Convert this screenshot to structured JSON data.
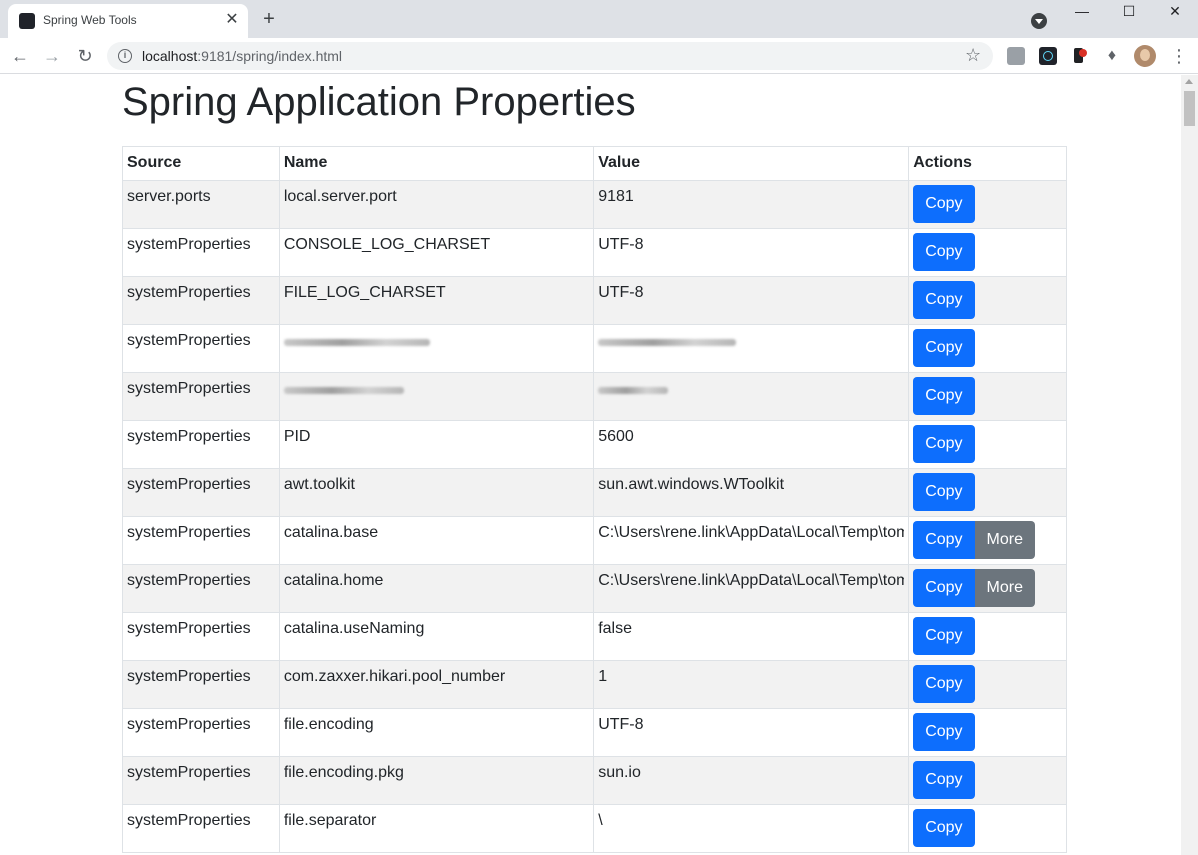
{
  "browser": {
    "tab_title": "Spring Web Tools",
    "tab_close": "✕",
    "new_tab": "+",
    "url_host": "localhost",
    "url_rest": ":9181/spring/index.html",
    "window_controls": {
      "minimize": "—",
      "maximize": "☐",
      "close": "✕"
    },
    "icons": [
      "react-favicon",
      "back-arrow-icon",
      "forward-arrow-icon",
      "reload-icon",
      "info-icon",
      "star-icon",
      "camera-icon",
      "react-devtools-icon",
      "extension-icon",
      "puzzle-icon",
      "profile-avatar",
      "menu-kebab-icon"
    ]
  },
  "page": {
    "title": "Spring Application Properties",
    "columns": [
      "Source",
      "Name",
      "Value",
      "Actions"
    ],
    "rows": [
      {
        "source": "server.ports",
        "name": "local.server.port",
        "value": "9181",
        "more": false
      },
      {
        "source": "systemProperties",
        "name": "CONSOLE_LOG_CHARSET",
        "value": "UTF-8",
        "more": false
      },
      {
        "source": "systemProperties",
        "name": "FILE_LOG_CHARSET",
        "value": "UTF-8",
        "more": false
      },
      {
        "source": "systemProperties",
        "name": "",
        "value": "",
        "redacted": true,
        "more": false
      },
      {
        "source": "systemProperties",
        "name": "",
        "value": "",
        "redacted": true,
        "more": false
      },
      {
        "source": "systemProperties",
        "name": "PID",
        "value": "5600",
        "more": false
      },
      {
        "source": "systemProperties",
        "name": "awt.toolkit",
        "value": "sun.awt.windows.WToolkit",
        "more": false
      },
      {
        "source": "systemProperties",
        "name": "catalina.base",
        "value": "C:\\Users\\rene.link\\AppData\\Local\\Temp\\tom",
        "more": true
      },
      {
        "source": "systemProperties",
        "name": "catalina.home",
        "value": "C:\\Users\\rene.link\\AppData\\Local\\Temp\\tom",
        "more": true
      },
      {
        "source": "systemProperties",
        "name": "catalina.useNaming",
        "value": "false",
        "more": false
      },
      {
        "source": "systemProperties",
        "name": "com.zaxxer.hikari.pool_number",
        "value": "1",
        "more": false
      },
      {
        "source": "systemProperties",
        "name": "file.encoding",
        "value": "UTF-8",
        "more": false
      },
      {
        "source": "systemProperties",
        "name": "file.encoding.pkg",
        "value": "sun.io",
        "more": false
      },
      {
        "source": "systemProperties",
        "name": "file.separator",
        "value": "\\",
        "more": false
      }
    ],
    "copy_label": "Copy",
    "more_label": "More"
  },
  "colors": {
    "primary": "#0d6efd",
    "secondary": "#6c757d",
    "stripe": "#f2f2f2"
  }
}
